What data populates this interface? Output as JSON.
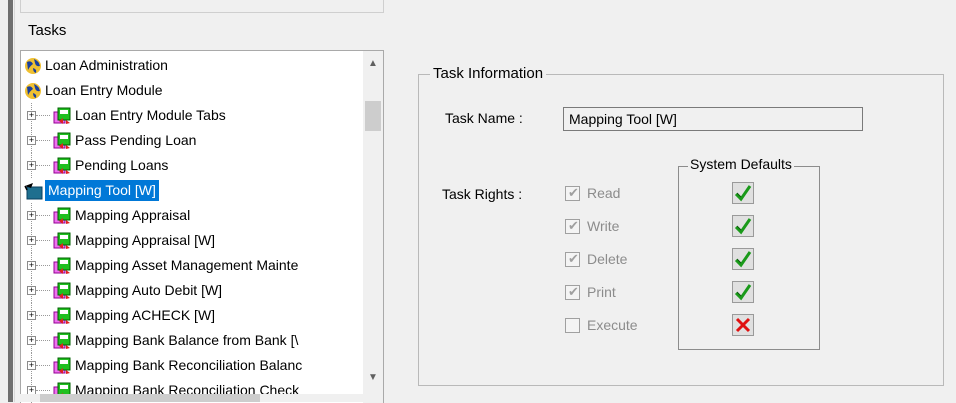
{
  "panel": {
    "tasks_label": "Tasks"
  },
  "tree": {
    "items": [
      {
        "label": "Loan Administration",
        "level": "top",
        "icon": "globe-icon"
      },
      {
        "label": "Loan Entry Module",
        "level": "top",
        "icon": "globe-icon"
      },
      {
        "label": "Loan Entry Module Tabs",
        "level": "child",
        "icon": "task-icon"
      },
      {
        "label": "Pass Pending Loan",
        "level": "child",
        "icon": "task-icon"
      },
      {
        "label": "Pending Loans",
        "level": "child",
        "icon": "task-icon"
      },
      {
        "label": "Mapping Tool [W]",
        "level": "top",
        "icon": "map-tool-icon",
        "selected": true
      },
      {
        "label": "Mapping Appraisal",
        "level": "child",
        "icon": "task-icon"
      },
      {
        "label": "Mapping Appraisal [W]",
        "level": "child",
        "icon": "task-icon"
      },
      {
        "label": "Mapping Asset Management Mainte",
        "level": "child",
        "icon": "task-icon"
      },
      {
        "label": "Mapping Auto Debit [W]",
        "level": "child",
        "icon": "task-icon"
      },
      {
        "label": "Mapping ACHECK [W]",
        "level": "child",
        "icon": "task-icon"
      },
      {
        "label": "Mapping Bank Balance from Bank [\\",
        "level": "child",
        "icon": "task-icon"
      },
      {
        "label": "Mapping Bank Reconciliation Balanc",
        "level": "child",
        "icon": "task-icon"
      },
      {
        "label": "Mapping Bank Reconciliation Check",
        "level": "child",
        "icon": "task-icon"
      }
    ]
  },
  "task_info": {
    "group_title": "Task Information",
    "task_name_label": "Task Name :",
    "task_name_value": "Mapping Tool [W]",
    "task_rights_label": "Task Rights :",
    "system_defaults_title": "System Defaults",
    "rights": [
      {
        "label": "Read",
        "checked": true,
        "default": "allowed"
      },
      {
        "label": "Write",
        "checked": true,
        "default": "allowed"
      },
      {
        "label": "Delete",
        "checked": true,
        "default": "allowed"
      },
      {
        "label": "Print",
        "checked": true,
        "default": "allowed"
      },
      {
        "label": "Execute",
        "checked": false,
        "default": "denied"
      }
    ]
  },
  "colors": {
    "selection": "#0078d7",
    "check_green": "#1a9a1a",
    "cross_red": "#e01010"
  }
}
